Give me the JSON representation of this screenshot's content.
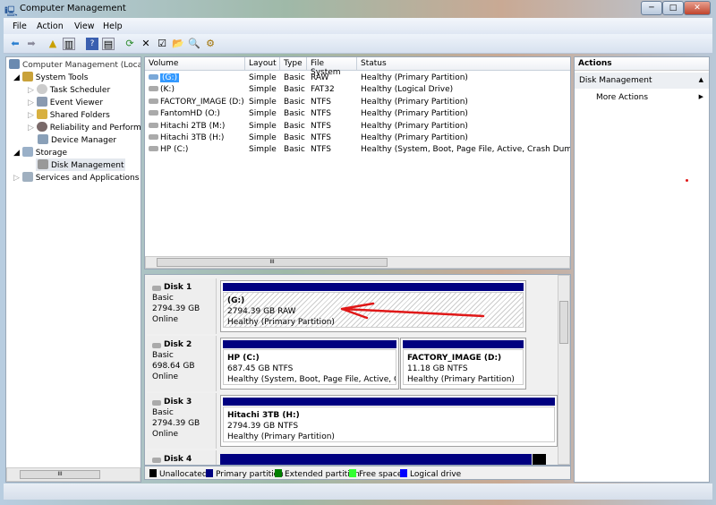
{
  "window": {
    "title": "Computer Management",
    "minimize": "─",
    "maximize": "□",
    "close": "✕"
  },
  "menu": [
    "File",
    "Action",
    "View",
    "Help"
  ],
  "toolbar": [
    "back-icon",
    "forward-icon",
    "up-icon",
    "show-hide-tree-icon",
    "help-icon",
    "show-hide-action-pane-icon",
    "refresh-icon",
    "delete-icon",
    "properties-icon",
    "open-icon",
    "search-icon",
    "settings-icon"
  ],
  "tree": {
    "root": "Computer Management (Local",
    "items": [
      {
        "label": "System Tools",
        "level": 1,
        "expanded": true
      },
      {
        "label": "Task Scheduler",
        "level": 2
      },
      {
        "label": "Event Viewer",
        "level": 2
      },
      {
        "label": "Shared Folders",
        "level": 2
      },
      {
        "label": "Reliability and Performa",
        "level": 2
      },
      {
        "label": "Device Manager",
        "level": 2
      },
      {
        "label": "Storage",
        "level": 1,
        "expanded": true
      },
      {
        "label": "Disk Management",
        "level": 2,
        "selected": true
      },
      {
        "label": "Services and Applications",
        "level": 1
      }
    ]
  },
  "list": {
    "columns": [
      "Volume",
      "Layout",
      "Type",
      "File System",
      "Status"
    ],
    "rows": [
      [
        "(G:)",
        "Simple",
        "Basic",
        "RAW",
        "Healthy (Primary Partition)"
      ],
      [
        "(K:)",
        "Simple",
        "Basic",
        "FAT32",
        "Healthy (Logical Drive)"
      ],
      [
        "FACTORY_IMAGE (D:)",
        "Simple",
        "Basic",
        "NTFS",
        "Healthy (Primary Partition)"
      ],
      [
        "FantomHD (O:)",
        "Simple",
        "Basic",
        "NTFS",
        "Healthy (Primary Partition)"
      ],
      [
        "Hitachi 2TB (M:)",
        "Simple",
        "Basic",
        "NTFS",
        "Healthy (Primary Partition)"
      ],
      [
        "Hitachi 3TB (H:)",
        "Simple",
        "Basic",
        "NTFS",
        "Healthy (Primary Partition)"
      ],
      [
        "HP (C:)",
        "Simple",
        "Basic",
        "NTFS",
        "Healthy (System, Boot, Page File, Active, Crash Dump, P"
      ]
    ],
    "hscroll_grip": "III"
  },
  "disks": [
    {
      "name": "Disk 1",
      "type": "Basic",
      "size": "2794.39 GB",
      "state": "Online",
      "partitions": [
        {
          "name": "(G:)",
          "size": "2794.39 GB RAW",
          "status": "Healthy (Primary Partition)"
        }
      ]
    },
    {
      "name": "Disk 2",
      "type": "Basic",
      "size": "698.64 GB",
      "state": "Online",
      "partitions": [
        {
          "name": "HP  (C:)",
          "size": "687.45 GB NTFS",
          "status": "Healthy (System, Boot, Page File, Active, Crash Dump"
        },
        {
          "name": "FACTORY_IMAGE  (D:)",
          "size": "11.18 GB NTFS",
          "status": "Healthy (Primary Partition)"
        }
      ]
    },
    {
      "name": "Disk 3",
      "type": "Basic",
      "size": "2794.39 GB",
      "state": "Online",
      "partitions": [
        {
          "name": "Hitachi 3TB  (H:)",
          "size": "2794.39 GB NTFS",
          "status": "Healthy (Primary Partition)"
        }
      ]
    },
    {
      "name": "Disk 4"
    }
  ],
  "legend": [
    {
      "label": "Unallocated",
      "color": "#000000"
    },
    {
      "label": "Primary partition",
      "color": "#000080"
    },
    {
      "label": "Extended partition",
      "color": "#008000"
    },
    {
      "label": "Free space",
      "color": "#33ff33"
    },
    {
      "label": "Logical drive",
      "color": "#0000ff"
    }
  ],
  "actions": {
    "header": "Actions",
    "section": "Disk Management",
    "more": "More Actions"
  },
  "annotation_color": "#e01818"
}
